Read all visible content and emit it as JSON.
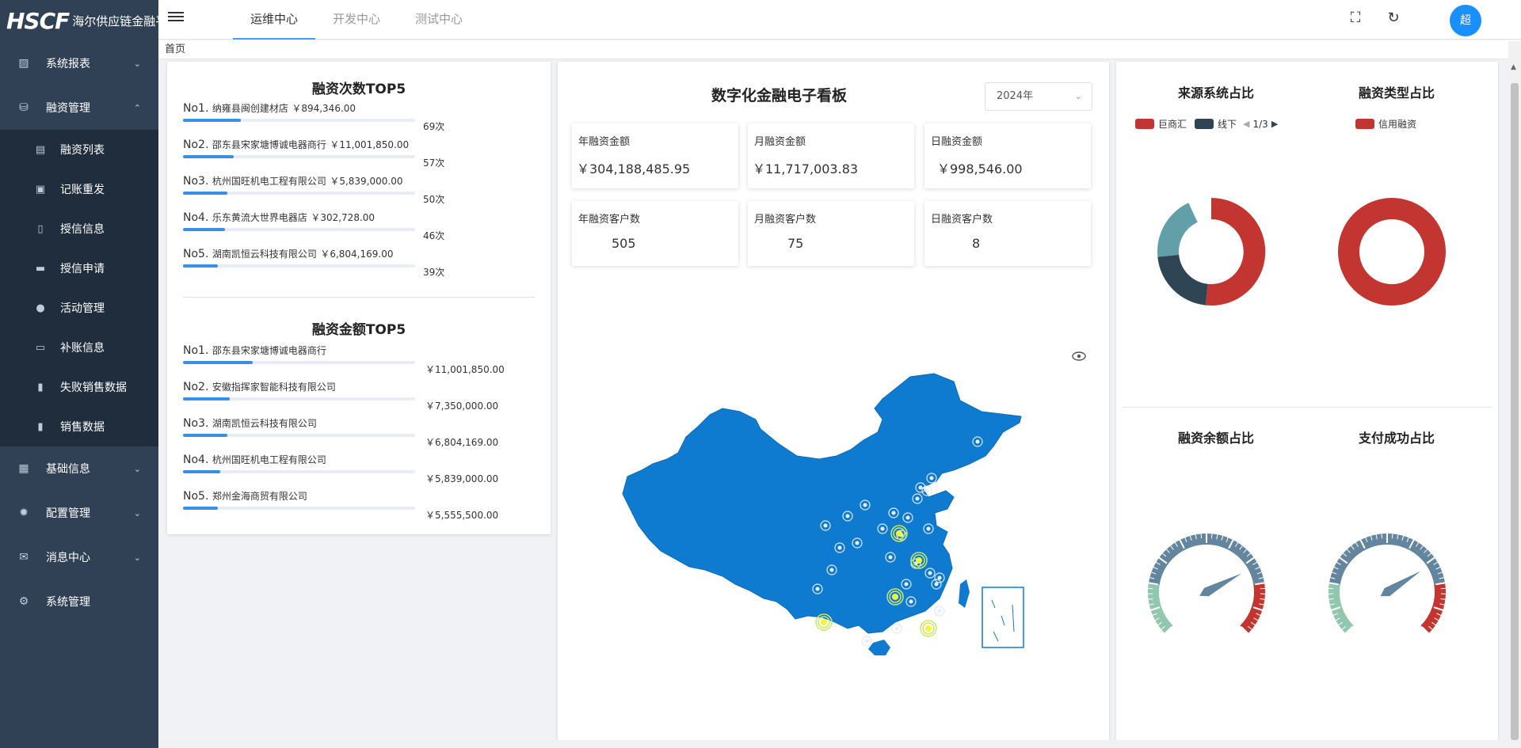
{
  "logo": {
    "mark": "HSCF",
    "name": "海尔供应链金融平台"
  },
  "sidebar": {
    "items": [
      {
        "label": "系统报表",
        "icon": "chart-icon",
        "chevron": "chevron-down-icon"
      },
      {
        "label": "融资管理",
        "icon": "database-icon",
        "chevron": "chevron-up-icon"
      },
      {
        "label": "基础信息",
        "icon": "grid-icon",
        "chevron": "chevron-down-icon"
      },
      {
        "label": "配置管理",
        "icon": "gear-icon",
        "chevron": "chevron-down-icon"
      },
      {
        "label": "消息中心",
        "icon": "mail-icon",
        "chevron": "chevron-down-icon"
      },
      {
        "label": "系统管理",
        "icon": "settings-icon"
      }
    ],
    "submenu": [
      {
        "label": "融资列表",
        "icon": "list-icon"
      },
      {
        "label": "记账重发",
        "icon": "lock-icon"
      },
      {
        "label": "授信信息",
        "icon": "document-icon"
      },
      {
        "label": "授信申请",
        "icon": "monitor-icon"
      },
      {
        "label": "活动管理",
        "icon": "bulb-icon"
      },
      {
        "label": "补账信息",
        "icon": "folder-plus-icon"
      },
      {
        "label": "失败销售数据",
        "icon": "clipboard-icon"
      },
      {
        "label": "销售数据",
        "icon": "clipboard-icon"
      }
    ]
  },
  "header": {
    "tabs": [
      "运维中心",
      "开发中心",
      "测试中心"
    ],
    "active_tab": 0,
    "avatar_text": "超"
  },
  "breadcrumb": "首页",
  "count_top5": {
    "title": "融资次数TOP5",
    "items": [
      {
        "rank": "No1.",
        "name": "纳雍县闽创建材店",
        "amount": "￥894,346.00",
        "count": "69次",
        "fill": 0.25
      },
      {
        "rank": "No2.",
        "name": "邵东县宋家塘博诚电器商行",
        "amount": "￥11,001,850.00",
        "count": "57次",
        "fill": 0.22
      },
      {
        "rank": "No3.",
        "name": "杭州国旺机电工程有限公司",
        "amount": "￥5,839,000.00",
        "count": "50次",
        "fill": 0.19
      },
      {
        "rank": "No4.",
        "name": "乐东黄流大世界电器店",
        "amount": "￥302,728.00",
        "count": "46次",
        "fill": 0.18
      },
      {
        "rank": "No5.",
        "name": "湖南凯恒云科技有限公司",
        "amount": "￥6,804,169.00",
        "count": "39次",
        "fill": 0.15
      }
    ]
  },
  "amount_top5": {
    "title": "融资金额TOP5",
    "items": [
      {
        "rank": "No1.",
        "name": "邵东县宋家塘博诚电器商行",
        "value": "￥11,001,850.00",
        "fill": 0.3
      },
      {
        "rank": "No2.",
        "name": "安徽指挥家智能科技有限公司",
        "value": "￥7,350,000.00",
        "fill": 0.2
      },
      {
        "rank": "No3.",
        "name": "湖南凯恒云科技有限公司",
        "value": "￥6,804,169.00",
        "fill": 0.19
      },
      {
        "rank": "No4.",
        "name": "杭州国旺机电工程有限公司",
        "value": "￥5,839,000.00",
        "fill": 0.16
      },
      {
        "rank": "No5.",
        "name": "郑州金海商贸有限公司",
        "value": "￥5,555,500.00",
        "fill": 0.15
      }
    ]
  },
  "board": {
    "title": "数字化金融电子看板",
    "year": "2024年",
    "stats": [
      {
        "label": "年融资金额",
        "value": "￥304,188,485.95"
      },
      {
        "label": "月融资金额",
        "value": "￥11,717,003.83"
      },
      {
        "label": "日融资金额",
        "value": "￥998,546.00"
      },
      {
        "label": "年融资客户数",
        "value": "505"
      },
      {
        "label": "月融资客户数",
        "value": "75"
      },
      {
        "label": "日融资客户数",
        "value": "8"
      }
    ]
  },
  "charts": {
    "source": {
      "title": "来源系统占比",
      "legend": [
        {
          "label": "巨商汇",
          "color": "#c23531"
        },
        {
          "label": "线下",
          "color": "#2f4554"
        }
      ],
      "pager": "1/3"
    },
    "type": {
      "title": "融资类型占比",
      "legend": [
        {
          "label": "信用融资",
          "color": "#c23531"
        }
      ]
    },
    "balance": {
      "title": "融资余额占比"
    },
    "pay": {
      "title": "支付成功占比"
    }
  },
  "colors": {
    "sidebar_bg": "#304156",
    "submenu_bg": "#1f2d3d",
    "accent": "#409eff",
    "map_blue": "#0f7bd0",
    "avatar": "#1890ff"
  }
}
